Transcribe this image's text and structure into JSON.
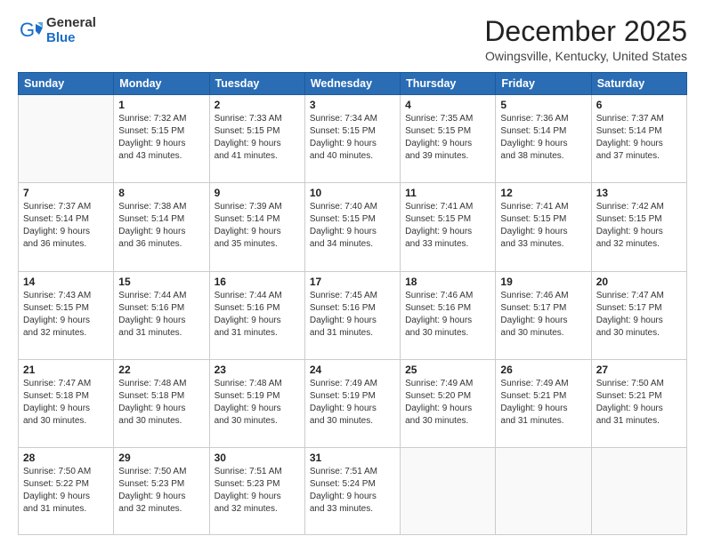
{
  "logo": {
    "general": "General",
    "blue": "Blue"
  },
  "title": "December 2025",
  "location": "Owingsville, Kentucky, United States",
  "weekdays": [
    "Sunday",
    "Monday",
    "Tuesday",
    "Wednesday",
    "Thursday",
    "Friday",
    "Saturday"
  ],
  "weeks": [
    [
      {
        "day": null,
        "info": null
      },
      {
        "day": "1",
        "info": "Sunrise: 7:32 AM\nSunset: 5:15 PM\nDaylight: 9 hours\nand 43 minutes."
      },
      {
        "day": "2",
        "info": "Sunrise: 7:33 AM\nSunset: 5:15 PM\nDaylight: 9 hours\nand 41 minutes."
      },
      {
        "day": "3",
        "info": "Sunrise: 7:34 AM\nSunset: 5:15 PM\nDaylight: 9 hours\nand 40 minutes."
      },
      {
        "day": "4",
        "info": "Sunrise: 7:35 AM\nSunset: 5:15 PM\nDaylight: 9 hours\nand 39 minutes."
      },
      {
        "day": "5",
        "info": "Sunrise: 7:36 AM\nSunset: 5:14 PM\nDaylight: 9 hours\nand 38 minutes."
      },
      {
        "day": "6",
        "info": "Sunrise: 7:37 AM\nSunset: 5:14 PM\nDaylight: 9 hours\nand 37 minutes."
      }
    ],
    [
      {
        "day": "7",
        "info": "Sunrise: 7:37 AM\nSunset: 5:14 PM\nDaylight: 9 hours\nand 36 minutes."
      },
      {
        "day": "8",
        "info": "Sunrise: 7:38 AM\nSunset: 5:14 PM\nDaylight: 9 hours\nand 36 minutes."
      },
      {
        "day": "9",
        "info": "Sunrise: 7:39 AM\nSunset: 5:14 PM\nDaylight: 9 hours\nand 35 minutes."
      },
      {
        "day": "10",
        "info": "Sunrise: 7:40 AM\nSunset: 5:15 PM\nDaylight: 9 hours\nand 34 minutes."
      },
      {
        "day": "11",
        "info": "Sunrise: 7:41 AM\nSunset: 5:15 PM\nDaylight: 9 hours\nand 33 minutes."
      },
      {
        "day": "12",
        "info": "Sunrise: 7:41 AM\nSunset: 5:15 PM\nDaylight: 9 hours\nand 33 minutes."
      },
      {
        "day": "13",
        "info": "Sunrise: 7:42 AM\nSunset: 5:15 PM\nDaylight: 9 hours\nand 32 minutes."
      }
    ],
    [
      {
        "day": "14",
        "info": "Sunrise: 7:43 AM\nSunset: 5:15 PM\nDaylight: 9 hours\nand 32 minutes."
      },
      {
        "day": "15",
        "info": "Sunrise: 7:44 AM\nSunset: 5:16 PM\nDaylight: 9 hours\nand 31 minutes."
      },
      {
        "day": "16",
        "info": "Sunrise: 7:44 AM\nSunset: 5:16 PM\nDaylight: 9 hours\nand 31 minutes."
      },
      {
        "day": "17",
        "info": "Sunrise: 7:45 AM\nSunset: 5:16 PM\nDaylight: 9 hours\nand 31 minutes."
      },
      {
        "day": "18",
        "info": "Sunrise: 7:46 AM\nSunset: 5:16 PM\nDaylight: 9 hours\nand 30 minutes."
      },
      {
        "day": "19",
        "info": "Sunrise: 7:46 AM\nSunset: 5:17 PM\nDaylight: 9 hours\nand 30 minutes."
      },
      {
        "day": "20",
        "info": "Sunrise: 7:47 AM\nSunset: 5:17 PM\nDaylight: 9 hours\nand 30 minutes."
      }
    ],
    [
      {
        "day": "21",
        "info": "Sunrise: 7:47 AM\nSunset: 5:18 PM\nDaylight: 9 hours\nand 30 minutes."
      },
      {
        "day": "22",
        "info": "Sunrise: 7:48 AM\nSunset: 5:18 PM\nDaylight: 9 hours\nand 30 minutes."
      },
      {
        "day": "23",
        "info": "Sunrise: 7:48 AM\nSunset: 5:19 PM\nDaylight: 9 hours\nand 30 minutes."
      },
      {
        "day": "24",
        "info": "Sunrise: 7:49 AM\nSunset: 5:19 PM\nDaylight: 9 hours\nand 30 minutes."
      },
      {
        "day": "25",
        "info": "Sunrise: 7:49 AM\nSunset: 5:20 PM\nDaylight: 9 hours\nand 30 minutes."
      },
      {
        "day": "26",
        "info": "Sunrise: 7:49 AM\nSunset: 5:21 PM\nDaylight: 9 hours\nand 31 minutes."
      },
      {
        "day": "27",
        "info": "Sunrise: 7:50 AM\nSunset: 5:21 PM\nDaylight: 9 hours\nand 31 minutes."
      }
    ],
    [
      {
        "day": "28",
        "info": "Sunrise: 7:50 AM\nSunset: 5:22 PM\nDaylight: 9 hours\nand 31 minutes."
      },
      {
        "day": "29",
        "info": "Sunrise: 7:50 AM\nSunset: 5:23 PM\nDaylight: 9 hours\nand 32 minutes."
      },
      {
        "day": "30",
        "info": "Sunrise: 7:51 AM\nSunset: 5:23 PM\nDaylight: 9 hours\nand 32 minutes."
      },
      {
        "day": "31",
        "info": "Sunrise: 7:51 AM\nSunset: 5:24 PM\nDaylight: 9 hours\nand 33 minutes."
      },
      {
        "day": null,
        "info": null
      },
      {
        "day": null,
        "info": null
      },
      {
        "day": null,
        "info": null
      }
    ]
  ]
}
